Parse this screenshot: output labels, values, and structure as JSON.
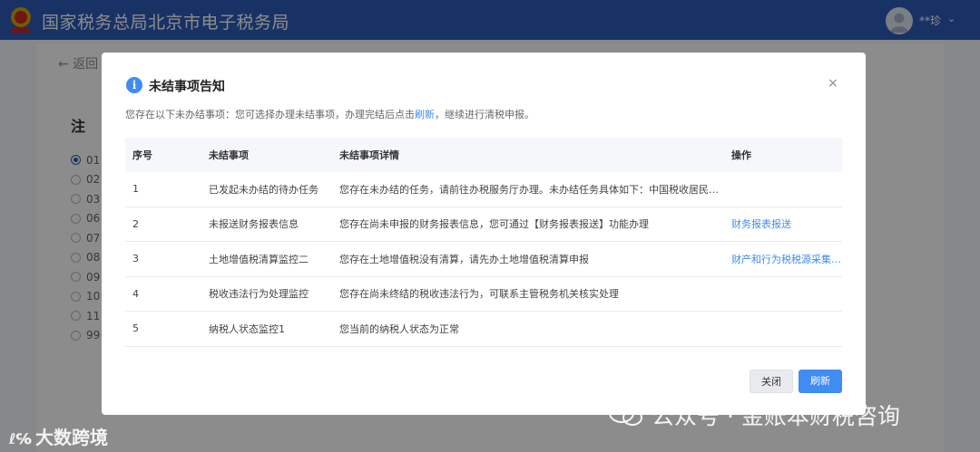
{
  "header": {
    "title": "国家税务总局北京市电子税务局",
    "user_name": "**珍",
    "user_caret": "⌄"
  },
  "background": {
    "back_label": "← 返回",
    "section_title": "注",
    "radio_items": [
      "01",
      "02",
      "03",
      "06",
      "07",
      "08",
      "09",
      "10",
      "11",
      "99"
    ]
  },
  "dialog": {
    "title": "未结事项告知",
    "info_icon": "i",
    "close_glyph": "×",
    "description_before": "您存在以下未办结事项：您可选择办理未结事项，办理完结后点击",
    "description_link": "刷新",
    "description_after": "，继续进行清税申报。",
    "columns": {
      "index": "序号",
      "item": "未结事项",
      "detail": "未结事项详情",
      "action": "操作"
    },
    "rows": [
      {
        "index": "1",
        "item": "已发起未办结的待办任务",
        "detail": "您存在未办结的任务，请前往办税服务厅办理。未办结任务具体如下：中国税收居民身份证明开具",
        "action": ""
      },
      {
        "index": "2",
        "item": "未报送财务报表信息",
        "detail": "您存在尚未申报的财务报表信息，您可通过【财务报表报送】功能办理",
        "action": "财务报表报送"
      },
      {
        "index": "3",
        "item": "土地增值税清算监控二",
        "detail": "您存在土地增值税没有清算，请先办土地增值税清算申报",
        "action": "财产和行为税税源采集及申报"
      },
      {
        "index": "4",
        "item": "税收违法行为处理监控",
        "detail": "您存在尚未终结的税收违法行为，可联系主管税务机关核实处理",
        "action": ""
      },
      {
        "index": "5",
        "item": "纳税人状态监控1",
        "detail": "您当前的纳税人状态为正常",
        "action": ""
      }
    ],
    "buttons": {
      "close": "关闭",
      "refresh": "刷新"
    }
  },
  "watermarks": {
    "left": "大数跨境",
    "left_symbol": "ℓ℅",
    "right": "公众号 · 金账本财税咨询"
  },
  "colors": {
    "brand": "#2e5bb8",
    "link": "#3f8cf3"
  }
}
